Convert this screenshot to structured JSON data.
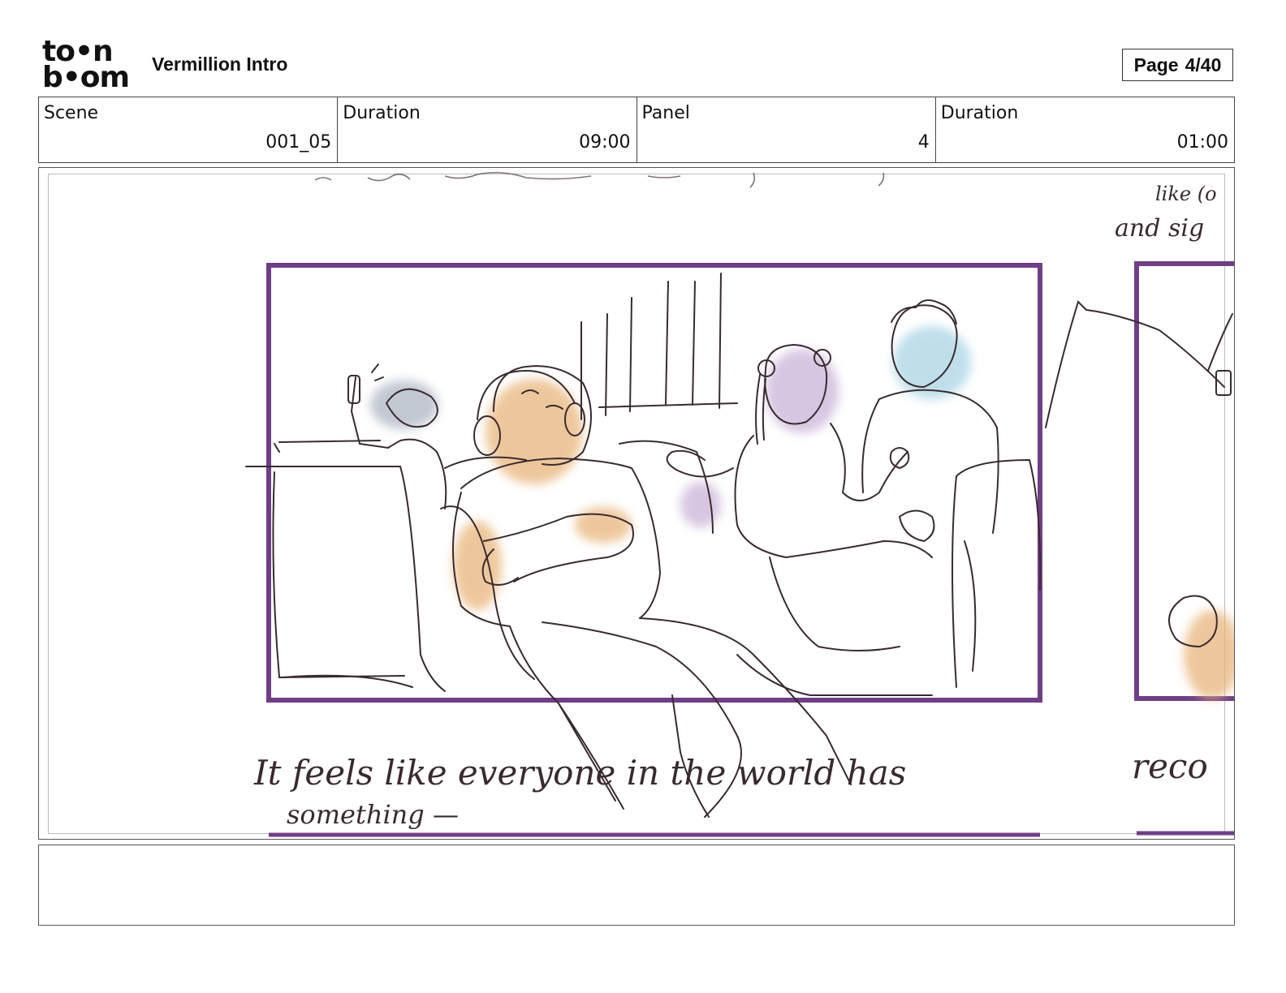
{
  "header": {
    "logo_top": "to•n",
    "logo_bottom": "b•om",
    "title": "Vermillion Intro",
    "page_label": "Page",
    "page_value": "4/40"
  },
  "info": {
    "scene_label": "Scene",
    "scene_value": "001_05",
    "scene_duration_label": "Duration",
    "scene_duration_value": "09:00",
    "panel_label": "Panel",
    "panel_value": "4",
    "panel_duration_label": "Duration",
    "panel_duration_value": "01:00"
  },
  "panel": {
    "caption_line1": "It feels like everyone in the world has",
    "caption_line2": "something —",
    "right_caption": "reco",
    "right_top_note_1": "like (o",
    "right_top_note_2": "and sig",
    "colors": {
      "frame": "#6f3f86",
      "pencil": "#3a2a30",
      "skin_orange": "#e8b57a",
      "hair_grey": "#aeb6c2",
      "hair_lilac": "#c9b4d8",
      "face_blue": "#a9d4e4"
    }
  },
  "notes": {}
}
